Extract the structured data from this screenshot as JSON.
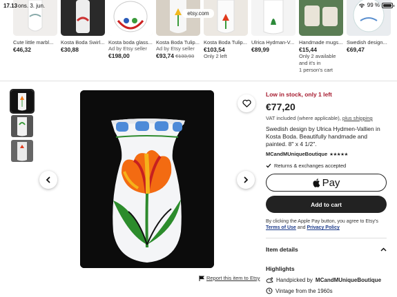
{
  "status": {
    "time": "17.13",
    "date": "ons. 3. jun.",
    "url": "etsy.com",
    "battery": "99 %"
  },
  "carousel": [
    {
      "title": "Cute little marbl...",
      "sub": "",
      "price": "€46,32",
      "old_price": "",
      "notes": []
    },
    {
      "title": "Kosta Boda Swirl...",
      "sub": "",
      "price": "€30,88",
      "old_price": "",
      "notes": []
    },
    {
      "title": "Kosta boda glass...",
      "sub": "Ad by Etsy seller",
      "price": "€198,00",
      "old_price": "",
      "notes": []
    },
    {
      "title": "Kosta Boda Tulip...",
      "sub": "Ad by Etsy seller",
      "price": "€93,74",
      "old_price": "€133,93",
      "notes": []
    },
    {
      "title": "Kosta Boda Tulip...",
      "sub": "",
      "price": "€103,54",
      "old_price": "",
      "notes": [
        "Only 2 left"
      ]
    },
    {
      "title": "Ulrica Hydman-V...",
      "sub": "",
      "price": "€89,99",
      "old_price": "",
      "notes": []
    },
    {
      "title": "Handmade mugs...",
      "sub": "",
      "price": "€15,44",
      "old_price": "",
      "notes": [
        "Only 2 available",
        "and it's in",
        "1 person's cart"
      ]
    },
    {
      "title": "Swedish design...",
      "sub": "",
      "price": "€69,47",
      "old_price": "",
      "notes": []
    }
  ],
  "product": {
    "low_stock": "Low in stock, only 1 left",
    "price": "€77,20",
    "vat_text": "VAT included (where applicable),",
    "shipping_link": "plus shipping",
    "description": "Swedish design by Ulrica Hydmen-Vallien in Kosta Boda. Beautifully handmade and painted. 8\" x 4 1/2\".",
    "shop_name": "MCandMUniqueBoutique",
    "stars": "★★★★★",
    "returns": "Returns & exchanges accepted",
    "apple_pay_label": "Pay",
    "add_to_cart": "Add to cart",
    "legal_prefix": "By clicking the Apple Pay button, you agree to Etsy's",
    "terms_link": "Terms of Use",
    "legal_and": "and",
    "privacy_link": "Privacy Policy",
    "item_details": "Item details",
    "highlights_title": "Highlights",
    "handpicked_prefix": "Handpicked by",
    "handpicked_shop": "MCandMUniqueBoutique",
    "vintage": "Vintage from the 1960s"
  },
  "report": "Report this item to Etsy",
  "colors": {
    "low_stock": "#a61a2e",
    "button_dark": "#222222",
    "link_blue": "#1b3a8a"
  }
}
